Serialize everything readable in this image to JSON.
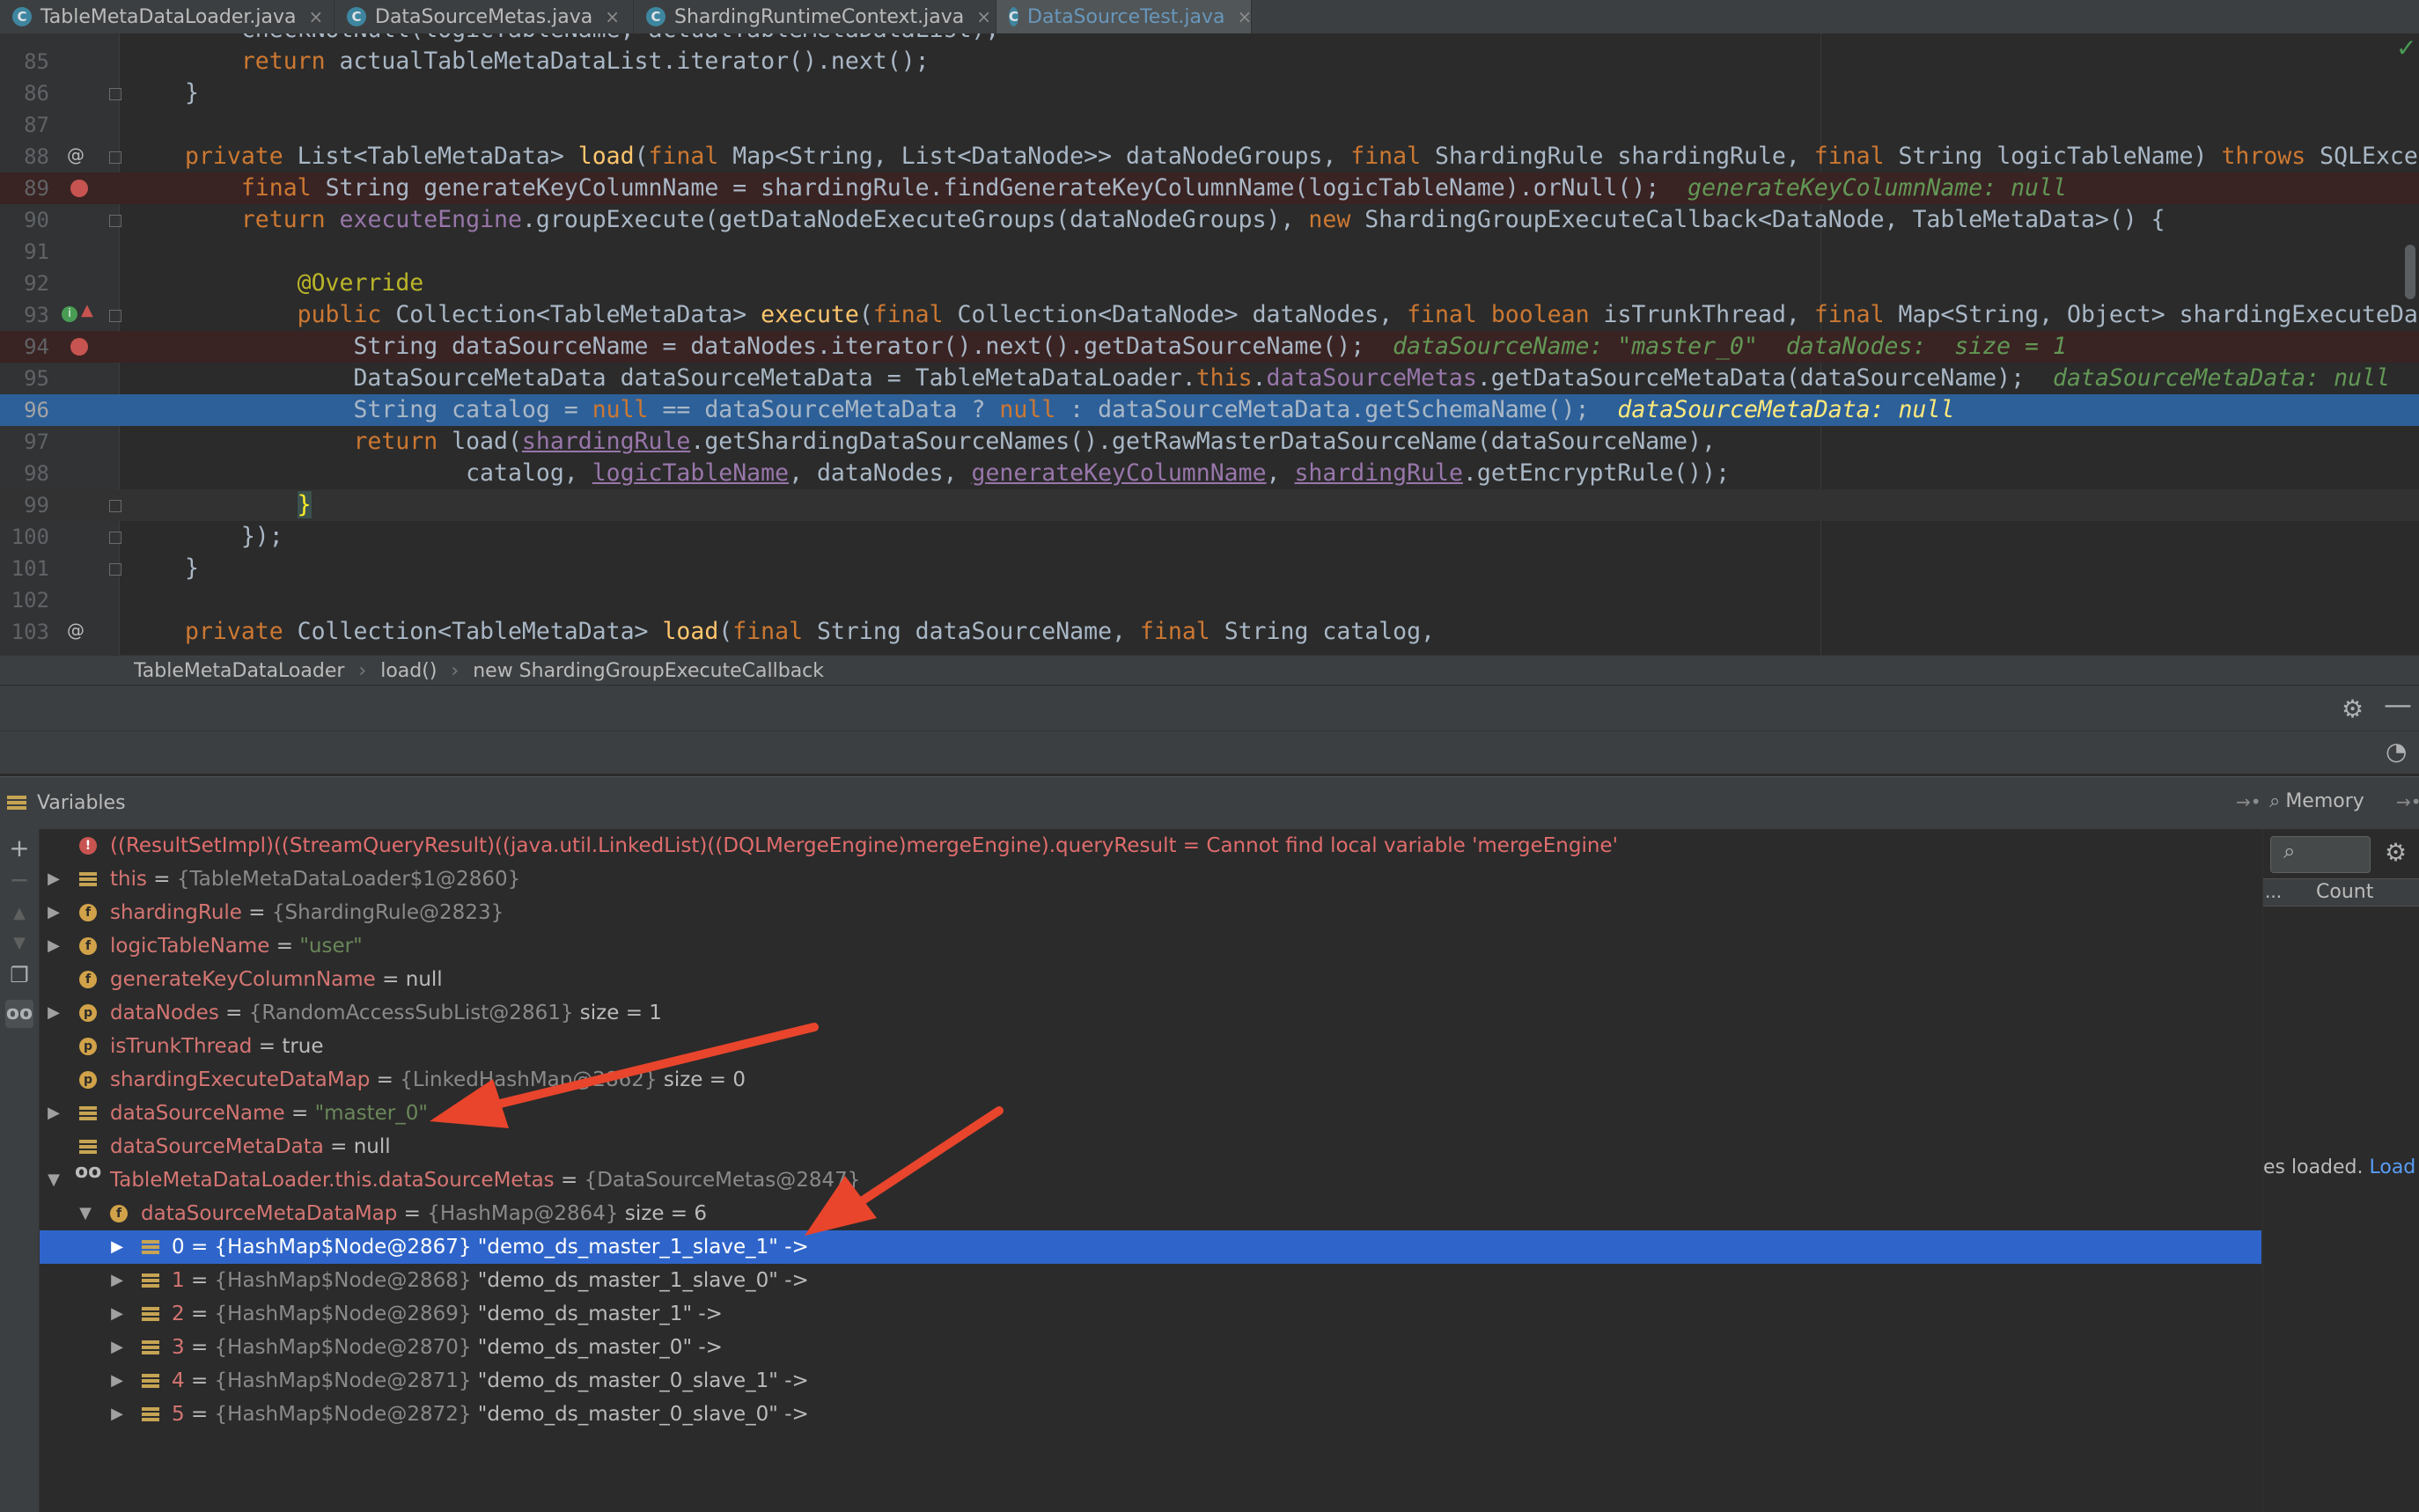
{
  "tabs": [
    {
      "label": "TableMetaDataLoader.java",
      "active": false
    },
    {
      "label": "DataSourceMetas.java",
      "active": false
    },
    {
      "label": "ShardingRuntimeContext.java",
      "active": false
    },
    {
      "label": "DataSourceTest.java",
      "active": true
    }
  ],
  "editor": {
    "lines": [
      {
        "num": "85"
      },
      {
        "num": "86"
      },
      {
        "num": "87"
      },
      {
        "num": "88"
      },
      {
        "num": "89"
      },
      {
        "num": "90"
      },
      {
        "num": "91"
      },
      {
        "num": "92"
      },
      {
        "num": "93"
      },
      {
        "num": "94"
      },
      {
        "num": "95"
      },
      {
        "num": "96"
      },
      {
        "num": "97"
      },
      {
        "num": "98"
      },
      {
        "num": "99"
      },
      {
        "num": "100"
      },
      {
        "num": "101"
      },
      {
        "num": "102"
      },
      {
        "num": "103"
      }
    ],
    "code": {
      "l84": "checkNotNull(logicTableName, actualTableMetaDataList);",
      "l85_return": "return",
      "l85_rest": " actualTableMetaDataList.iterator().next();",
      "l86": "}",
      "l88_private": "private",
      "l88_a": " List<TableMetaData> ",
      "l88_load": "load",
      "l88_b": "(",
      "l88_final1": "final",
      "l88_c": " Map<String, List<DataNode>> dataNodeGroups, ",
      "l88_final2": "final",
      "l88_d": " ShardingRule shardingRule, ",
      "l88_final3": "final",
      "l88_e": " String logicTableName) ",
      "l88_throws": "throws",
      "l88_f": " SQLExce",
      "l89_final": "final",
      "l89_a": " String generateKeyColumnName = shardingRule.findGenerateKeyColumnName(logicTableName).orNull();",
      "l89_hint": "generateKeyColumnName: null",
      "l90_return": "return",
      "l90_a": " ",
      "l90_field": "executeEngine",
      "l90_b": ".groupExecute(getDataNodeExecuteGroups(dataNodeGroups), ",
      "l90_new": "new",
      "l90_c": " ShardingGroupExecuteCallback<DataNode, TableMetaData>() {",
      "l92_ann": "@Override",
      "l93_public": "public",
      "l93_a": " Collection<TableMetaData> ",
      "l93_exec": "execute",
      "l93_b": "(",
      "l93_final1": "final",
      "l93_c": " Collection<DataNode> dataNodes, ",
      "l93_final2": "final",
      "l93_d": " ",
      "l93_boolean": "boolean",
      "l93_e": " isTrunkThread, ",
      "l93_final3": "final",
      "l93_f": " Map<String, Object> shardingExecuteDa",
      "l94_a": "String dataSourceName = dataNodes.iterator().next().getDataSourceName();",
      "l94_hint": "dataSourceName: \"master_0\"  dataNodes:  size = 1",
      "l95_a": "DataSourceMetaData dataSourceMetaData = TableMetaDataLoader.",
      "l95_this": "this",
      "l95_b": ".",
      "l95_field": "dataSourceMetas",
      "l95_c": ".getDataSourceMetaData(dataSourceName);",
      "l95_hint": "dataSourceMetaData: null",
      "l96_a": "String catalog = ",
      "l96_null1": "null",
      "l96_b": " == dataSourceMetaData ? ",
      "l96_null2": "null",
      "l96_c": " : dataSourceMetaData.getSchemaName();",
      "l96_hint": "dataSourceMetaData: null",
      "l97_return": "return",
      "l97_a": " load(",
      "l97_rule": "shardingRule",
      "l97_b": ".getShardingDataSourceNames().getRawMasterDataSourceName(dataSourceName),",
      "l98_a": "catalog, ",
      "l98_ltn": "logicTableName",
      "l98_b": ", dataNodes, ",
      "l98_gkc": "generateKeyColumnName",
      "l98_c": ", ",
      "l98_rule": "shardingRule",
      "l98_d": ".getEncryptRule());",
      "l99": "}",
      "l100": "});",
      "l101": "}",
      "l103_private": "private",
      "l103_a": " Collection<TableMetaData> ",
      "l103_load": "load",
      "l103_b": "(",
      "l103_final1": "final",
      "l103_c": " String dataSourceName, ",
      "l103_final2": "final",
      "l103_d": " String catalog,"
    }
  },
  "breadcrumb": [
    "TableMetaDataLoader",
    "load()",
    "new ShardingGroupExecuteCallback"
  ],
  "breadcrumb_sep": "›",
  "variables_panel": {
    "title": "Variables",
    "memory_tab": "Memory",
    "memory_count_header": "Count",
    "memory_dots": "...",
    "memory_loaded_text": "es loaded. ",
    "memory_load_link": "Load",
    "rows": [
      {
        "name": "((ResultSetImpl)((StreamQueryResult)((java.util.LinkedList)((DQLMergeEngine)mergeEngine).queryResult",
        "eq": " = ",
        "value": "Cannot find local variable 'mergeEngine'"
      },
      {
        "name": "this",
        "eq": " = ",
        "ref": "{TableMetaDataLoader$1@2860}"
      },
      {
        "name": "shardingRule",
        "eq": " = ",
        "ref": "{ShardingRule@2823}"
      },
      {
        "name": "logicTableName",
        "eq": " = ",
        "str": "\"user\""
      },
      {
        "name": "generateKeyColumnName",
        "eq": " = ",
        "plain": "null"
      },
      {
        "name": "dataNodes",
        "eq": " = ",
        "ref": "{RandomAccessSubList@2861}",
        "plain": " size = 1"
      },
      {
        "name": "isTrunkThread",
        "eq": " = ",
        "plain": "true"
      },
      {
        "name": "shardingExecuteDataMap",
        "eq": " = ",
        "ref": "{LinkedHashMap@2862}",
        "plain": " size = 0"
      },
      {
        "name": "dataSourceName",
        "eq": " = ",
        "str": "\"master_0\""
      },
      {
        "name": "dataSourceMetaData",
        "eq": " = ",
        "plain": "null"
      },
      {
        "name": "TableMetaDataLoader.this.dataSourceMetas",
        "eq": " = ",
        "ref": "{DataSourceMetas@2847}"
      },
      {
        "name": "dataSourceMetaDataMap",
        "eq": " = ",
        "ref": "{HashMap@2864}",
        "plain": " size = 6"
      },
      {
        "name": "0",
        "eq": " = ",
        "ref": "{HashMap$Node@2867}",
        "plain": " \"demo_ds_master_1_slave_1\" ->"
      },
      {
        "name": "1",
        "eq": " = ",
        "ref": "{HashMap$Node@2868}",
        "plain": " \"demo_ds_master_1_slave_0\" ->"
      },
      {
        "name": "2",
        "eq": " = ",
        "ref": "{HashMap$Node@2869}",
        "plain": " \"demo_ds_master_1\" ->"
      },
      {
        "name": "3",
        "eq": " = ",
        "ref": "{HashMap$Node@2870}",
        "plain": " \"demo_ds_master_0\" ->"
      },
      {
        "name": "4",
        "eq": " = ",
        "ref": "{HashMap$Node@2871}",
        "plain": " \"demo_ds_master_0_slave_1\" ->"
      },
      {
        "name": "5",
        "eq": " = ",
        "ref": "{HashMap$Node@2872}",
        "plain": " \"demo_ds_master_0_slave_0\" ->"
      }
    ]
  },
  "icons": {
    "close": "×",
    "gear": "⚙",
    "minimize": "—",
    "search": "⌕",
    "plus": "+",
    "minus": "−",
    "up": "▲",
    "down": "▼",
    "copy": "❐",
    "glasses": "oo",
    "pin": "→•",
    "arrow_right": "▶",
    "arrow_down": "▼",
    "meter": "◔",
    "check": "✓",
    "err": "!",
    "f": "f",
    "p": "p",
    "at": "@",
    "info": "i"
  },
  "colors": {
    "selection": "#2f65ca",
    "breakpoint": "#c75450",
    "annotation_arrow": "#e8452c"
  }
}
